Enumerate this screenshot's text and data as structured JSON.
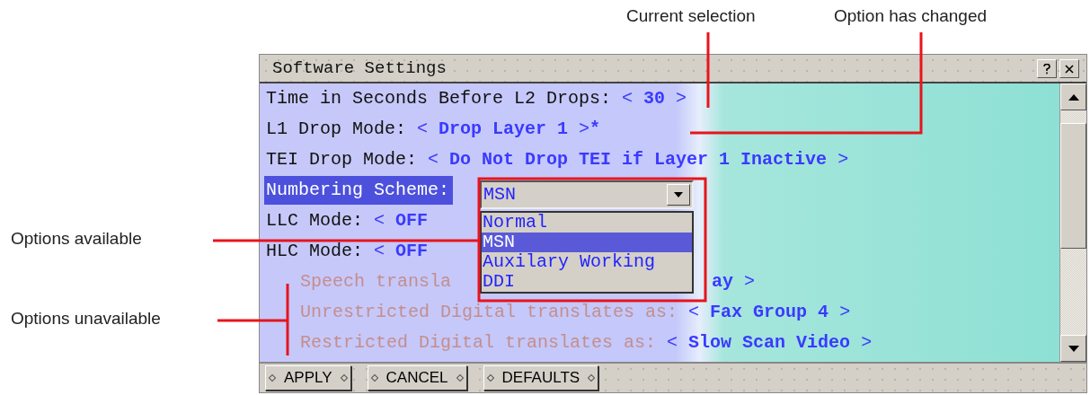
{
  "annotations": [
    {
      "text": "Current selection"
    },
    {
      "text": "Option has changed"
    },
    {
      "text": "Options available"
    },
    {
      "text": "Options unavailable"
    }
  ],
  "window": {
    "title": "Software Settings"
  },
  "settings": [
    {
      "kind": "value",
      "label": "Time in Seconds Before L2 Drops:",
      "value": "< **30** >",
      "selected": false,
      "disabled": false
    },
    {
      "kind": "value",
      "label": "L1 Drop Mode:",
      "value": "< **Drop Layer 1** >",
      "marker": "*",
      "selected": false,
      "disabled": false
    },
    {
      "kind": "value",
      "label": "TEI Drop Mode:",
      "value": "< **Do Not Drop TEI if Layer 1 Inactive** >",
      "selected": false,
      "disabled": false
    },
    {
      "kind": "dropdown",
      "label": "Numbering Scheme:",
      "selected": true,
      "disabled": false
    },
    {
      "kind": "value",
      "label": "LLC Mode:",
      "value": "< **OFF**",
      "selected": false,
      "disabled": false
    },
    {
      "kind": "value",
      "label": "HLC Mode:",
      "value": "< **OFF**",
      "selected": false,
      "disabled": false
    },
    {
      "kind": "split",
      "label": "Speech transla",
      "value": "**ay** >",
      "selected": false,
      "disabled": true
    },
    {
      "kind": "value",
      "label": "Unrestricted Digital translates as:",
      "value": "< **Fax Group 4** >",
      "selected": false,
      "disabled": true
    },
    {
      "kind": "value",
      "label": "Restricted Digital translates as:",
      "value": "< **Slow Scan Video** >",
      "selected": false,
      "disabled": true
    }
  ],
  "dropdown": {
    "value": "MSN",
    "options": [
      {
        "label": "Normal",
        "selected": false
      },
      {
        "label": "MSN",
        "selected": true
      },
      {
        "label": "Auxilary Working",
        "selected": false
      },
      {
        "label": "DDI",
        "selected": false
      }
    ]
  },
  "buttons": [
    "APPLY",
    "CANCEL",
    "DEFAULTS"
  ]
}
